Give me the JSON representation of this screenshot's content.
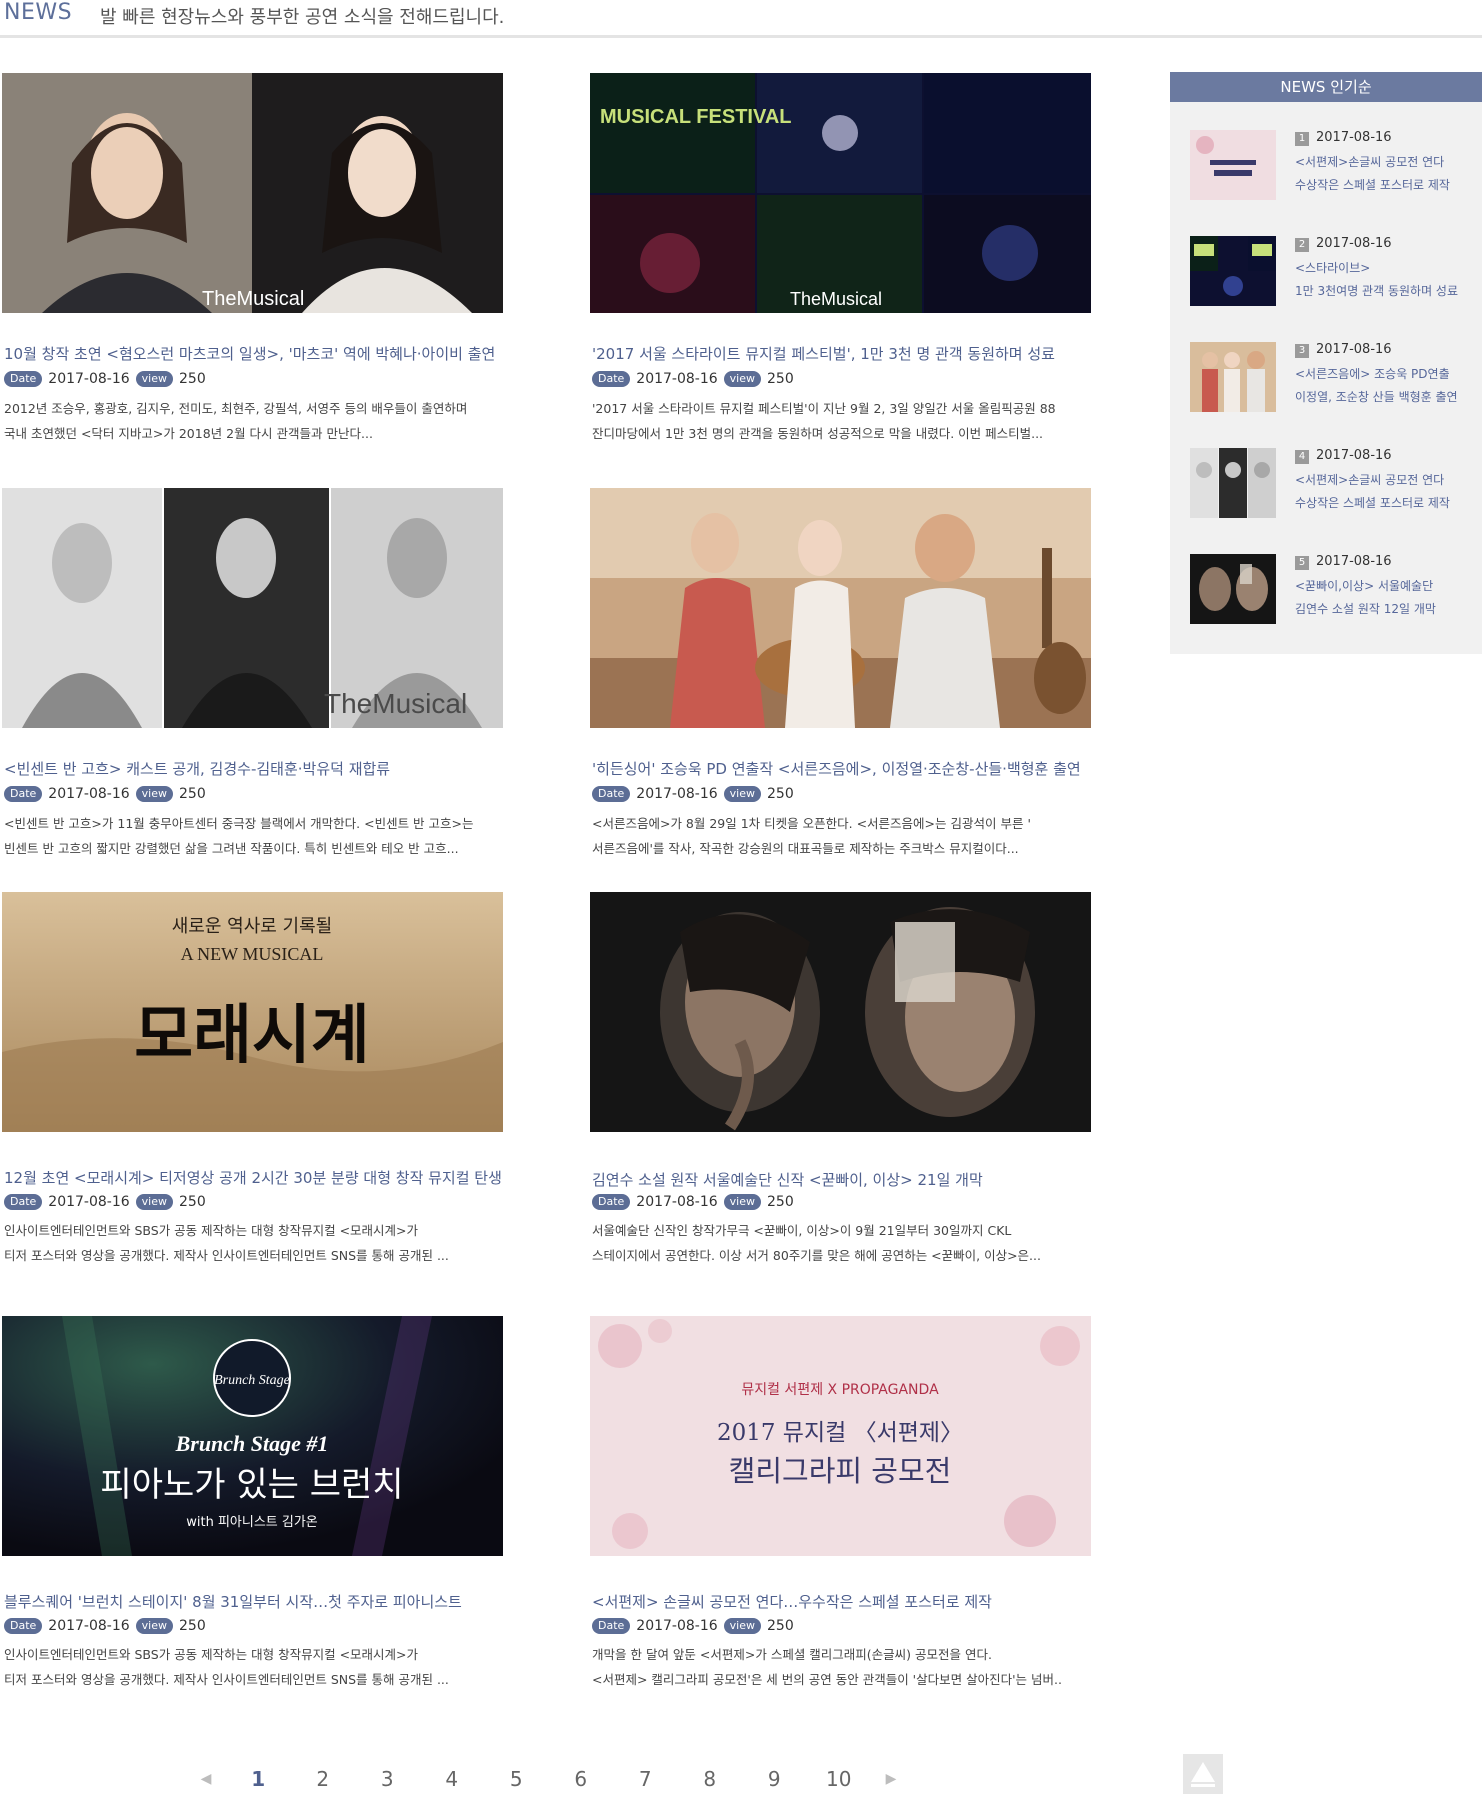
{
  "header": {
    "section": "NEWS",
    "subtitle": "발 빠른 현장뉴스와 풍부한 공연 소식을 전해드립니다."
  },
  "labels": {
    "date": "Date",
    "view": "view"
  },
  "articles": [
    {
      "title": "10월 창작 초연 <혐오스런 마츠코의 일생>, '마츠코' 역에 박혜나·아이비 출연",
      "date": "2017-08-16",
      "views": "250",
      "desc1": "2012년 조승우, 홍광호, 김지우, 전미도, 최현주, 강필석, 서영주 등의 배우들이 출연하며",
      "desc2": "국내 초연했던 <닥터 지바고>가 2018년 2월 다시 관객들과 만난다...",
      "image_text": "TheMusical"
    },
    {
      "title": "'2017 서울 스타라이트 뮤지컬 페스티벌', 1만 3천 명 관객 동원하며 성료",
      "date": "2017-08-16",
      "views": "250",
      "desc1": "'2017 서울 스타라이트 뮤지컬 페스티벌'이 지난 9월 2, 3일 양일간 서울 올림픽공원 88",
      "desc2": "잔디마당에서 1만 3천 명의 관객을 동원하며 성공적으로 막을 내렸다. 이번 페스티벌...",
      "image_text": "MUSICAL FESTIVAL",
      "image_text2": "TheMusical"
    },
    {
      "title": "<빈센트 반 고흐> 캐스트 공개, 김경수-김태훈·박유덕 재합류",
      "date": "2017-08-16",
      "views": "250",
      "desc1": "<빈센트 반 고흐>가 11월 충무아트센터 중극장 블랙에서 개막한다. <빈센트 반 고흐>는",
      "desc2": "빈센트 반 고흐의 짧지만 강렬했던 삶을 그려낸 작품이다. 특히 빈센트와 테오 반 고흐...",
      "image_text": "TheMusical"
    },
    {
      "title": "'히든싱어' 조승욱 PD 연출작 <서른즈음에>, 이정열·조순창-산들·백형훈 출연",
      "date": "2017-08-16",
      "views": "250",
      "desc1": "<서른즈음에>가 8월 29일 1차 티켓을 오픈한다. <서른즈음에>는 김광석이 부른 '",
      "desc2": "서른즈음에'를 작사, 작곡한 강승원의 대표곡들로 제작하는 주크박스 뮤지컬이다..."
    },
    {
      "title": "12월 초연 <모래시계> 티저영상 공개 2시간 30분 분량 대형 창작 뮤지컬 탄생",
      "date": "2017-08-16",
      "views": "250",
      "desc1": "인사이트엔터테인먼트와 SBS가 공동 제작하는 대형 창작뮤지컬 <모래시계>가",
      "desc2": "티저 포스터와 영상을 공개했다.  제작사 인사이트엔터테인먼트 SNS를 통해 공개된 ...",
      "image_text": "새로운 역사로 기록될",
      "image_text2": "A NEW MUSICAL",
      "image_text3": "모래시계"
    },
    {
      "title": "김연수 소설 원작 서울예술단 신작 <꾿빠이, 이상> 21일 개막",
      "date": "2017-08-16",
      "views": "250",
      "desc1": "서울예술단 신작인 창작가무극 <꾿빠이, 이상>이 9월 21일부터 30일까지 CKL",
      "desc2": "스테이지에서 공연한다. 이상 서거 80주기를 맞은 해에 공연하는 <꾿빠이, 이상>은..."
    },
    {
      "title": "블루스퀘어 '브런치 스테이지' 8월 31일부터 시작…첫 주자로 피아니스트",
      "date": "2017-08-16",
      "views": "250",
      "desc1": "인사이트엔터테인먼트와 SBS가 공동 제작하는 대형 창작뮤지컬 <모래시계>가",
      "desc2": "티저 포스터와 영상을 공개했다.  제작사 인사이트엔터테인먼트 SNS를 통해 공개된 ...",
      "image_text": "Brunch Stage #1",
      "image_text2": "피아노가 있는 브런치",
      "image_text3": "with 피아니스트 김가온",
      "image_text4": "Brunch Stage"
    },
    {
      "title": "<서편제> 손글씨 공모전 연다…우수작은 스페셜 포스터로 제작",
      "date": "2017-08-16",
      "views": "250",
      "desc1": "개막을 한 달여 앞둔 <서편제>가 스페셜 캘리그래피(손글씨) 공모전을 연다.",
      "desc2": "<서편제> 캘리그라피 공모전'은 세 번의 공연 동안 관객들이 '살다보면 살아진다'는 넘버..",
      "image_text": "뮤지컬 서편제 X PROPAGANDA",
      "image_text2": "2017 뮤지컬 〈서편제〉",
      "image_text3": "캘리그라피 공모전"
    }
  ],
  "sidebar": {
    "heading_prefix": "NEWS",
    "heading_suffix": "인기순",
    "items": [
      {
        "rank": "1",
        "date": "2017-08-16",
        "line1": "<서편제>손글씨 공모전 연다",
        "line2": "수상작은 스페셜 포스터로 제작"
      },
      {
        "rank": "2",
        "date": "2017-08-16",
        "line1": "<스타라이브>",
        "line2": "1만 3천여명 관객 동원하며 성료"
      },
      {
        "rank": "3",
        "date": "2017-08-16",
        "line1": "<서른즈음에> 조승욱 PD연출",
        "line2": "이정열, 조순창 산들 백형훈 출연"
      },
      {
        "rank": "4",
        "date": "2017-08-16",
        "line1": "<서편제>손글씨 공모전 연다",
        "line2": "수상작은 스페셜 포스터로 제작"
      },
      {
        "rank": "5",
        "date": "2017-08-16",
        "line1": "<꾿빠이,이상> 서울예술단",
        "line2": "김연수 소설 원작 12일 개막"
      }
    ]
  },
  "pagination": {
    "prev_icon": "◀",
    "next_icon": "▶",
    "pages": [
      "1",
      "2",
      "3",
      "4",
      "5",
      "6",
      "7",
      "8",
      "9",
      "10"
    ],
    "current": "1"
  },
  "top_button_icon": "triangle-up-icon",
  "colors": {
    "accent": "#4f608e",
    "tag_bg": "#5c6d95",
    "sidebar_head": "#6b7aa0",
    "sidebar_bg": "#f1f1f1"
  }
}
